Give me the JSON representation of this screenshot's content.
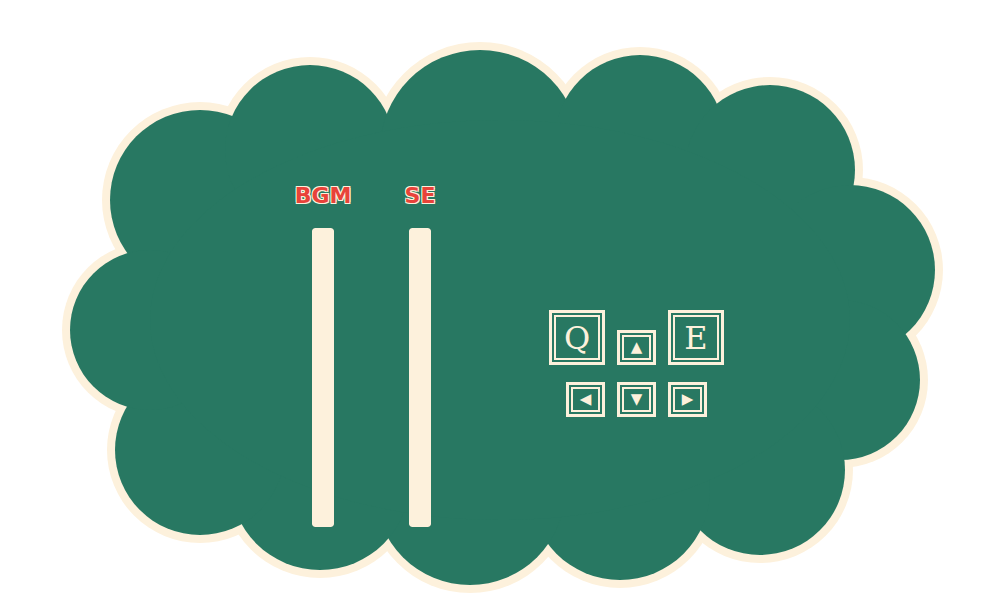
{
  "panel": {
    "sliders": [
      {
        "label": "BGM",
        "level": 1
      },
      {
        "label": "SE",
        "level": 1
      }
    ],
    "key_rows": [
      [
        {
          "label": "Q",
          "kind": "letter"
        },
        {
          "label": "▲",
          "kind": "arrow"
        },
        {
          "label": "E",
          "kind": "letter"
        }
      ],
      [
        {
          "label": "◀",
          "kind": "arrow"
        },
        {
          "label": "▼",
          "kind": "arrow"
        },
        {
          "label": "▶",
          "kind": "arrow"
        }
      ]
    ]
  }
}
